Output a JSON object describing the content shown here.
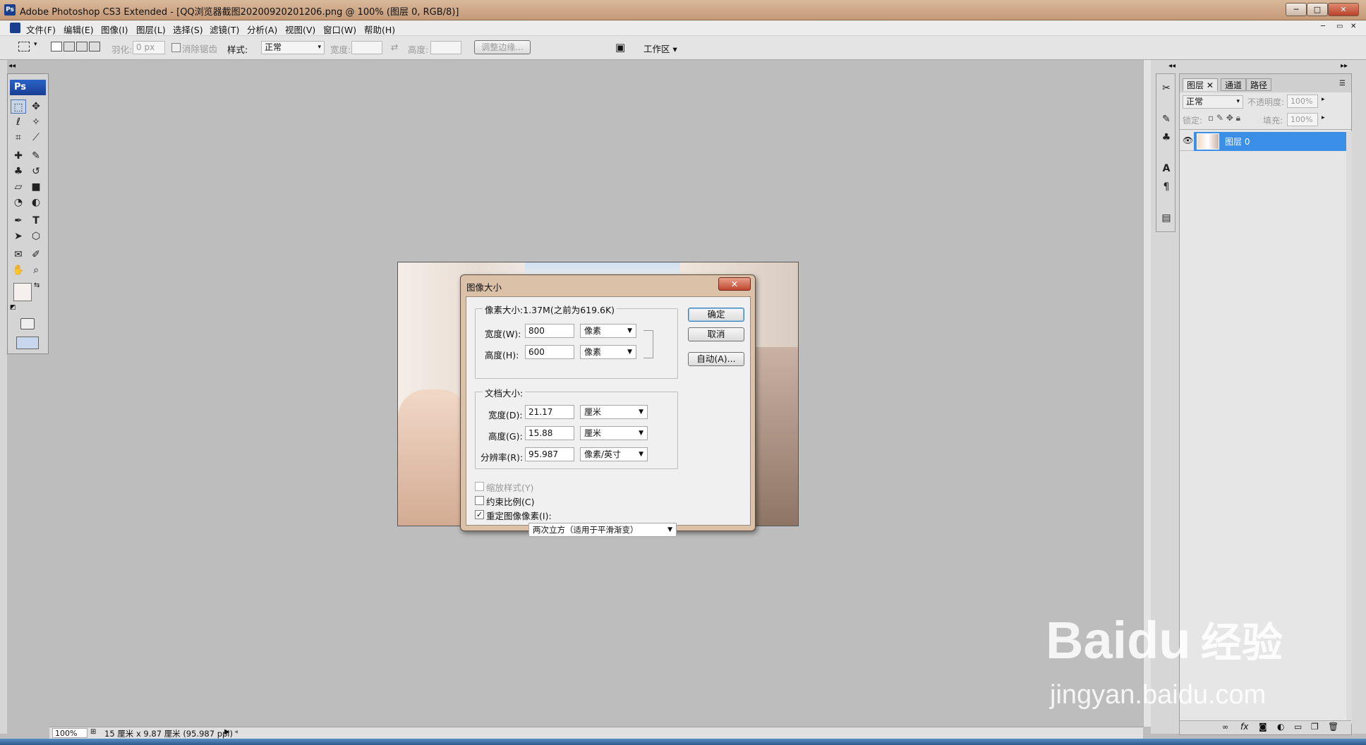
{
  "window": {
    "title": "Adobe Photoshop CS3 Extended - [QQ浏览器截图20200920201206.png @ 100% (图层 0, RGB/8)]",
    "app_icon": "Ps"
  },
  "menu": [
    "文件(F)",
    "编辑(E)",
    "图像(I)",
    "图层(L)",
    "选择(S)",
    "滤镜(T)",
    "分析(A)",
    "视图(V)",
    "窗口(W)",
    "帮助(H)"
  ],
  "options": {
    "feather_label": "羽化:",
    "feather_value": "0 px",
    "antialias_label": "消除锯齿",
    "style_label": "样式:",
    "style_value": "正常",
    "width_label": "宽度:",
    "height_label": "高度:",
    "refine_edge": "调整边缘...",
    "workspace": "工作区 ▾"
  },
  "toolbox": {
    "header": "Ps"
  },
  "dialog": {
    "title": "图像大小",
    "pixel_group": "像素大小:1.37M(之前为619.6K)",
    "width_label": "宽度(W):",
    "width_value": "800",
    "width_unit": "像素",
    "height_label": "高度(H):",
    "height_value": "600",
    "height_unit": "像素",
    "doc_group": "文档大小:",
    "doc_width_label": "宽度(D):",
    "doc_width_value": "21.17",
    "doc_width_unit": "厘米",
    "doc_height_label": "高度(G):",
    "doc_height_value": "15.88",
    "doc_height_unit": "厘米",
    "res_label": "分辨率(R):",
    "res_value": "95.987",
    "res_unit": "像素/英寸",
    "scale_styles": "缩放样式(Y)",
    "constrain": "约束比例(C)",
    "resample": "重定图像像素(I):",
    "resample_method": "两次立方（适用于平滑渐变）",
    "ok": "确定",
    "cancel": "取消",
    "auto": "自动(A)..."
  },
  "layers_panel": {
    "tabs": [
      "图层",
      "通道",
      "路径"
    ],
    "blend_mode": "正常",
    "opacity_label": "不透明度:",
    "opacity_value": "100%",
    "lock_label": "锁定:",
    "fill_label": "填充:",
    "fill_value": "100%",
    "layer_name": "图层 0"
  },
  "status": {
    "zoom": "100%",
    "doc_info": "15 厘米 x 9.87 厘米 (95.987 ppi)"
  },
  "watermark": {
    "brand": "Baidu",
    "brand_cn": "经验",
    "url": "jingyan.baidu.com"
  },
  "colors": {
    "selected_layer": "#3b8fe6",
    "title_bar": "#c9a181",
    "panel_header": "#1a3f93"
  }
}
